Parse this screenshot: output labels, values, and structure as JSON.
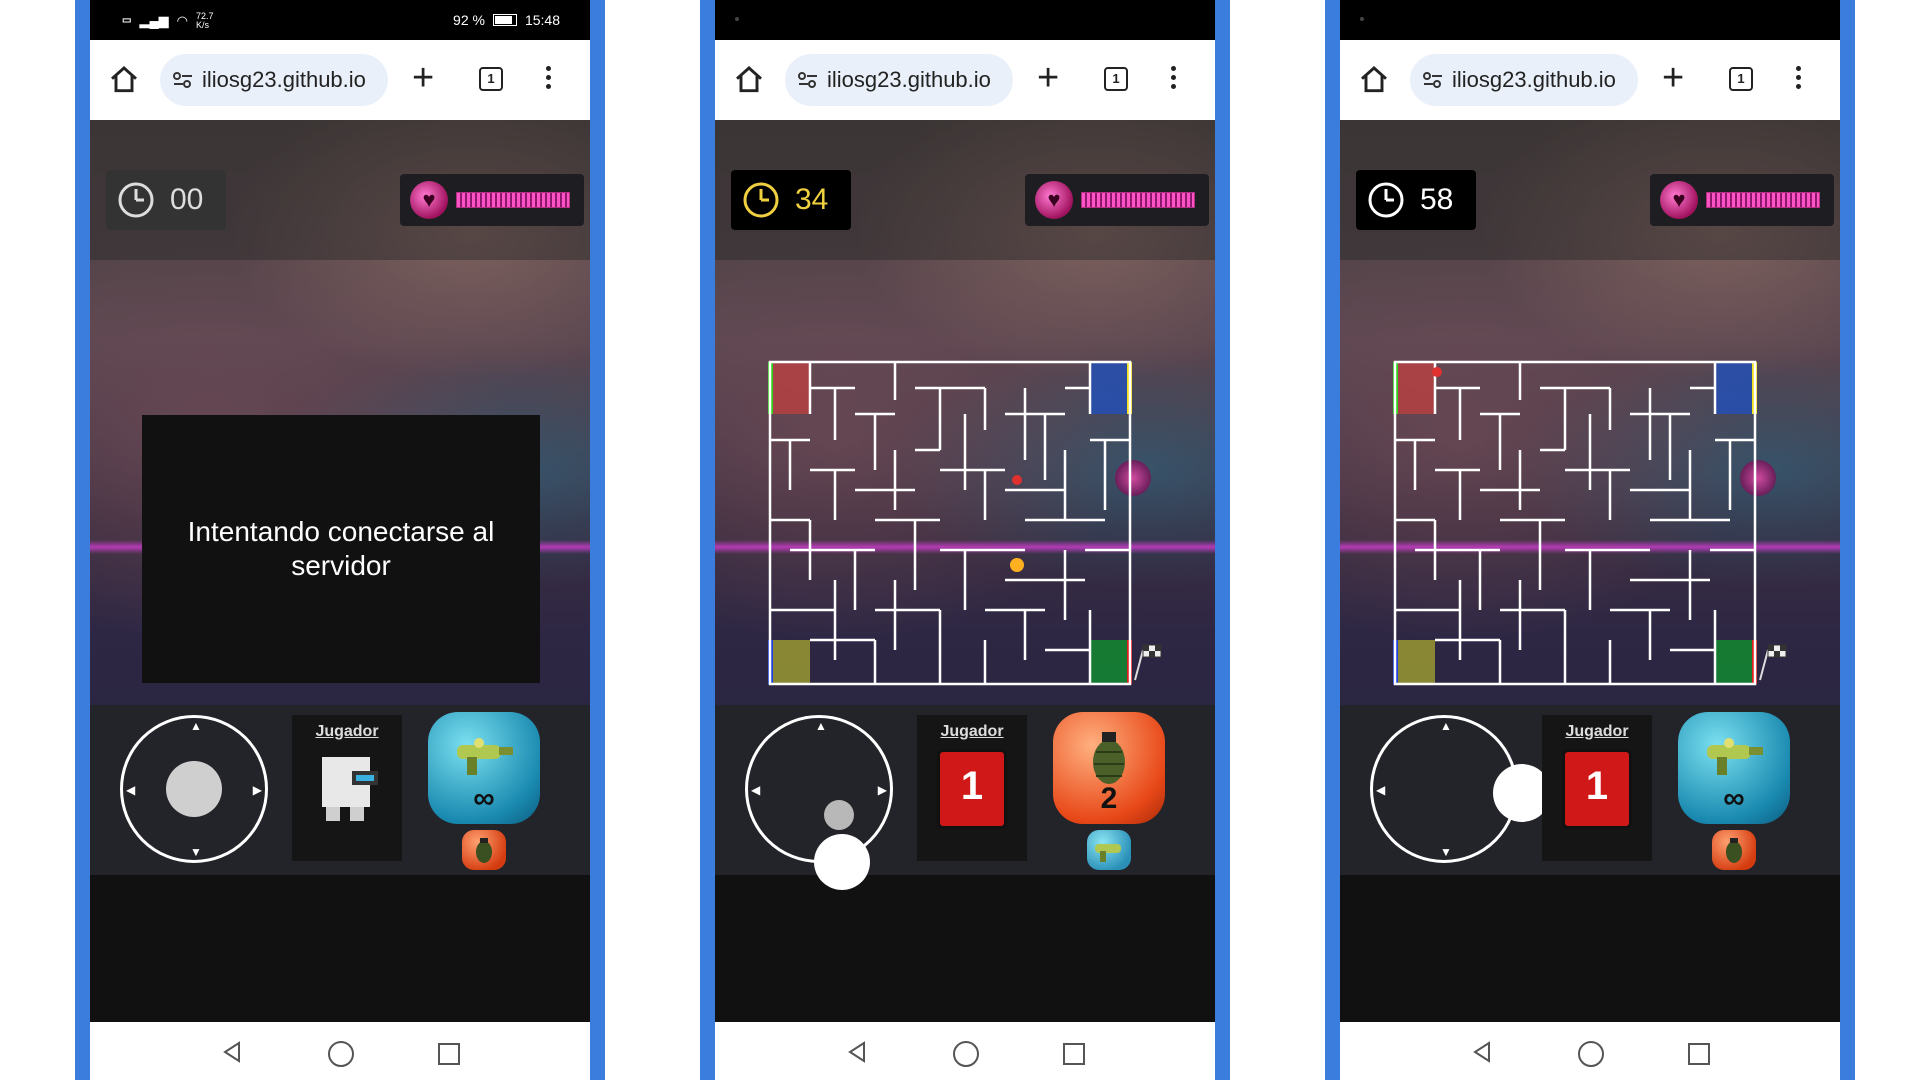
{
  "browser": {
    "domain": "iliosg23.github.io",
    "tab_count": "1"
  },
  "panels": [
    {
      "status": {
        "data_speed": "72.7",
        "data_unit": "K/s",
        "battery": "92 %",
        "time": "15:48"
      },
      "timer": "00",
      "connect_message": "Intentando conectarse al servidor",
      "player_label": "Jugador",
      "weapon_count": "∞"
    },
    {
      "timer": "34",
      "player_label": "Jugador",
      "player_number": "1",
      "weapon_count": "2"
    },
    {
      "timer": "58",
      "player_label": "Jugador",
      "player_number": "1",
      "weapon_count": "∞"
    }
  ],
  "colors": {
    "frame": "#3a7ddc",
    "timer_panel2": "#000000",
    "maze_lines": "#ffffff",
    "corner_red": "#c04040",
    "corner_blue": "#2050c0",
    "corner_yellow": "#a0a030",
    "corner_green": "#109030"
  }
}
